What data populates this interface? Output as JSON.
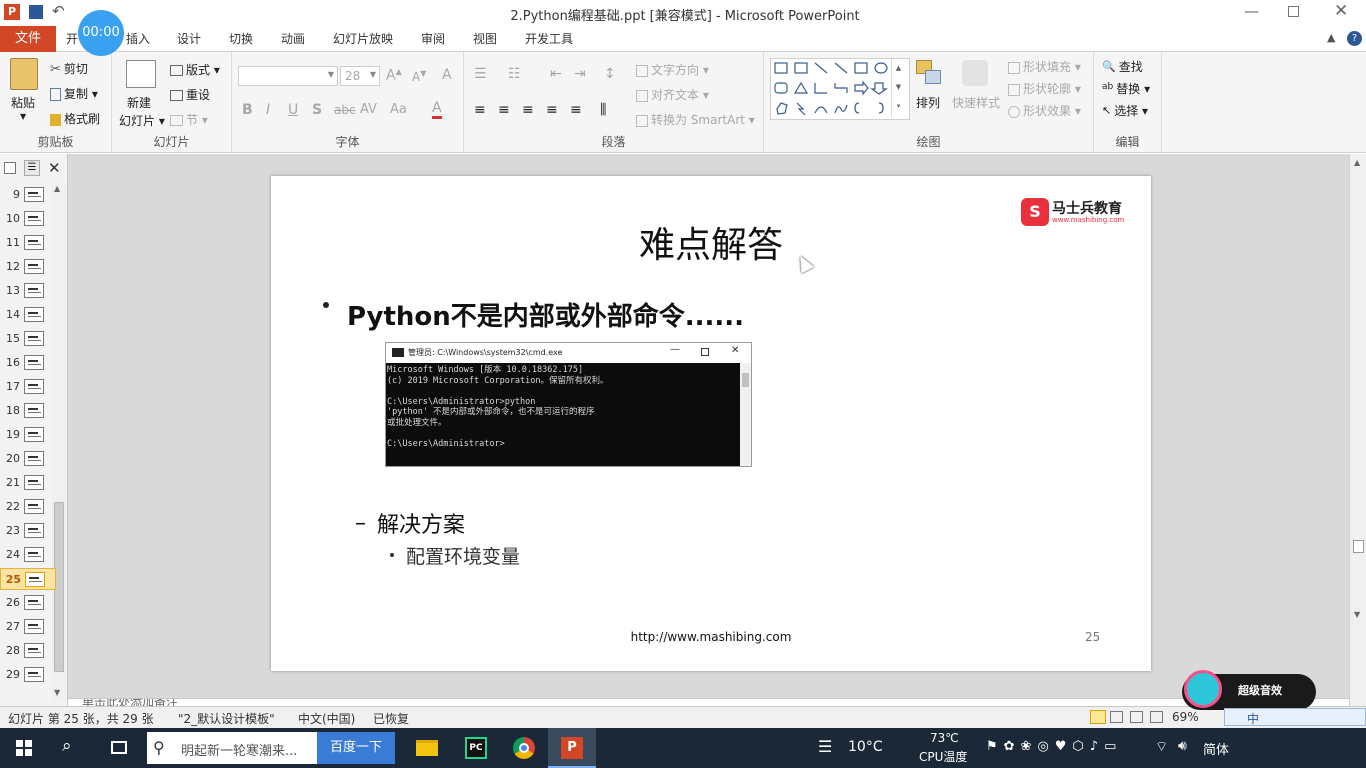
{
  "window": {
    "title": "2.Python编程基础.ppt [兼容模式] - Microsoft PowerPoint",
    "timer": "00:00"
  },
  "tabs": [
    "文件",
    "开",
    "插入",
    "设计",
    "切换",
    "动画",
    "幻灯片放映",
    "审阅",
    "视图",
    "开发工具"
  ],
  "ribbon": {
    "clipboard": {
      "paste": "粘贴",
      "cut": "剪切",
      "copy": "复制",
      "format_painter": "格式刷",
      "label": "剪贴板"
    },
    "slides": {
      "new_slide_1": "新建",
      "new_slide_2": "幻灯片",
      "layout": "版式",
      "reset": "重设",
      "section": "节",
      "label": "幻灯片"
    },
    "font": {
      "size": "28",
      "label": "字体"
    },
    "paragraph": {
      "text_direction": "文字方向",
      "align_text": "对齐文本",
      "smartart": "转换为 SmartArt",
      "label": "段落"
    },
    "drawing": {
      "arrange": "排列",
      "quick_styles": "快速样式",
      "shape_fill": "形状填充",
      "shape_outline": "形状轮廓",
      "shape_effects": "形状效果",
      "label": "绘图"
    },
    "editing": {
      "find": "查找",
      "replace": "替换",
      "select": "选择",
      "label": "编辑"
    }
  },
  "thumbnails": [
    "9",
    "10",
    "11",
    "12",
    "13",
    "14",
    "15",
    "16",
    "17",
    "18",
    "19",
    "20",
    "21",
    "22",
    "23",
    "24",
    "25",
    "26",
    "27",
    "28",
    "29"
  ],
  "current_slide": "25",
  "slide": {
    "title": "难点解答",
    "logo_text": "马士兵教育",
    "logo_url": "www.mashibing.com",
    "bullet1": "Python不是内部或外部命令......",
    "sub_bullet": "解决方案",
    "sub_sub_bullet": "配置环境变量",
    "footer_url": "http://www.mashibing.com",
    "page_number": "25",
    "cmd": {
      "title": "管理员: C:\\Windows\\system32\\cmd.exe",
      "lines": [
        "Microsoft Windows [版本 10.0.18362.175]",
        "(c) 2019 Microsoft Corporation。保留所有权利。",
        "",
        "C:\\Users\\Administrator>python",
        "'python' 不是内部或外部命令，也不是可运行的程序",
        "或批处理文件。",
        "",
        "C:\\Users\\Administrator>"
      ]
    }
  },
  "notes_placeholder": "单击此处添加备注",
  "statusbar": {
    "slide_info": "幻灯片 第 25 张，共 29 张",
    "template": "\"2_默认设计模板\"",
    "language": "中文(中国)",
    "recovered": "已恢复",
    "zoom": "69%"
  },
  "taskbar": {
    "search_placeholder": "明起新一轮寒潮来...",
    "search_button": "百度一下",
    "weather": "10°C",
    "cpu_temp": "73℃",
    "cpu_label": "CPU温度",
    "ime": "简体",
    "overlay_text": "超级音效",
    "ime_mode": "中"
  }
}
